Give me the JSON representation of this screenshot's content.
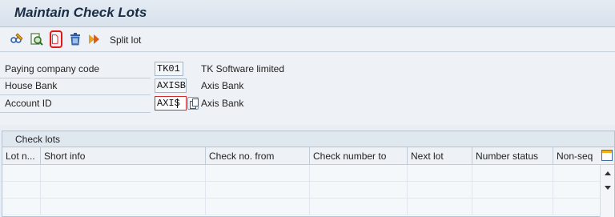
{
  "window": {
    "title": "Maintain Check Lots"
  },
  "toolbar": {
    "icons": [
      "glasses-pencil-icon",
      "find-doc-icon",
      "create-doc-icon",
      "delete-icon",
      "split-icon"
    ],
    "split_lot_label": "Split lot"
  },
  "form": {
    "paying_company_code": {
      "label": "Paying company code",
      "value": "TK01",
      "description": "TK Software limited"
    },
    "house_bank": {
      "label": "House Bank",
      "value": "AXISB",
      "description": "Axis Bank"
    },
    "account_id": {
      "label": "Account ID",
      "value": "AXIS",
      "description": "Axis Bank"
    }
  },
  "table": {
    "caption": "Check lots",
    "columns": [
      "Lot n...",
      "Short info",
      "Check no. from",
      "Check number to",
      "Next lot",
      "Number status",
      "Non-seq"
    ],
    "rows": []
  },
  "colors": {
    "accent_red": "#d42a2a",
    "header_bg": "#dfe7ef",
    "page_bg": "#eef2f6"
  }
}
